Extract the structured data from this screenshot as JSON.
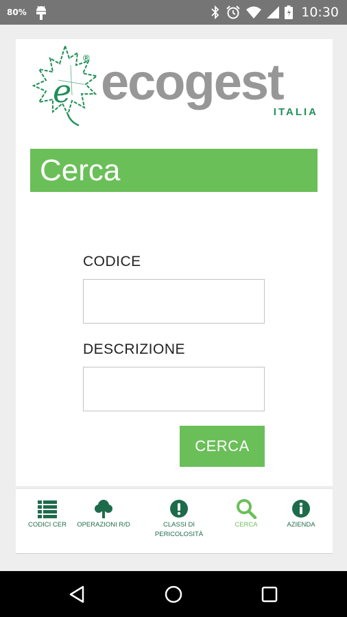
{
  "status_bar": {
    "battery_percent": "80%",
    "time": "10:30"
  },
  "logo": {
    "brand": "ecogest",
    "tagline": "ITALIA",
    "registered": "®"
  },
  "page": {
    "title": "Cerca"
  },
  "form": {
    "codice_label": "CODICE",
    "codice_value": "",
    "descrizione_label": "DESCRIZIONE",
    "descrizione_value": "",
    "submit_label": "CERCA"
  },
  "bottom_nav": {
    "items": [
      {
        "label": "CODICI CER",
        "icon": "list-icon",
        "active": false
      },
      {
        "label": "OPERAZIONI R/D",
        "icon": "tree-icon",
        "active": false
      },
      {
        "label": "CLASSI DI PERICOLOSITÀ",
        "icon": "exclamation-icon",
        "active": false
      },
      {
        "label": "CERCA",
        "icon": "search-icon",
        "active": true
      },
      {
        "label": "AZIENDA",
        "icon": "info-icon",
        "active": false
      }
    ]
  },
  "colors": {
    "accent_green": "#6bbf59",
    "dark_green": "#1e6b4b",
    "logo_grey": "#979797",
    "status_bar": "#757575"
  }
}
